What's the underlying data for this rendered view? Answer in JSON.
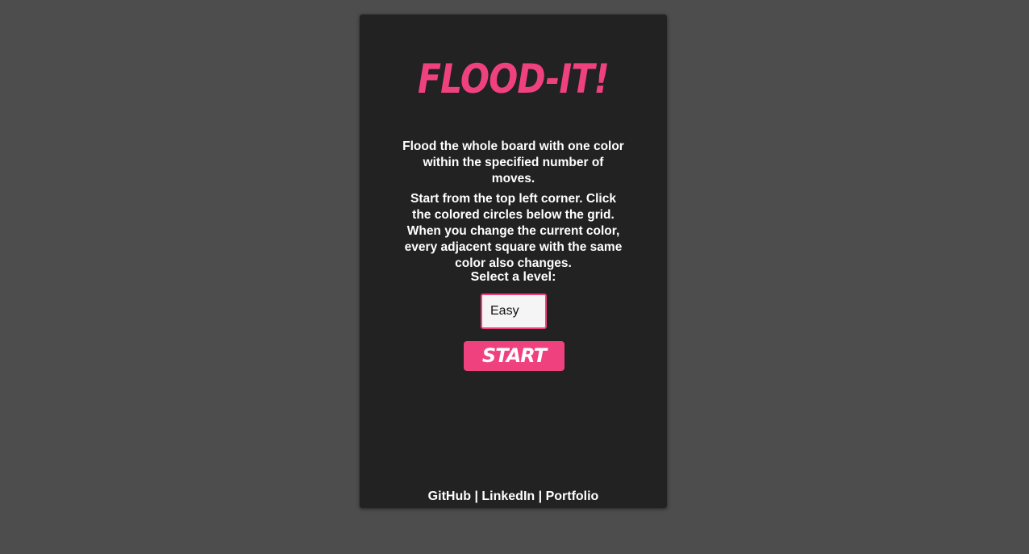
{
  "game": {
    "title": "FLOOD-IT!",
    "instructions_1": "Flood the whole board with one color within the specified number of moves.",
    "instructions_2": "Start from the top left corner. Click the colored circles below the grid. When you change the current color, every adjacent square with the same color also changes.",
    "level_label": "Select a level:",
    "level_selected": "Easy",
    "start_label": "START"
  },
  "footer": {
    "github": "GitHub",
    "separator": "|",
    "linkedin": "LinkedIn",
    "portfolio": "Portfolio"
  },
  "colors": {
    "background": "#4d4d4d",
    "card": "#222222",
    "accent": "#f0417f",
    "text": "#ffffff"
  }
}
